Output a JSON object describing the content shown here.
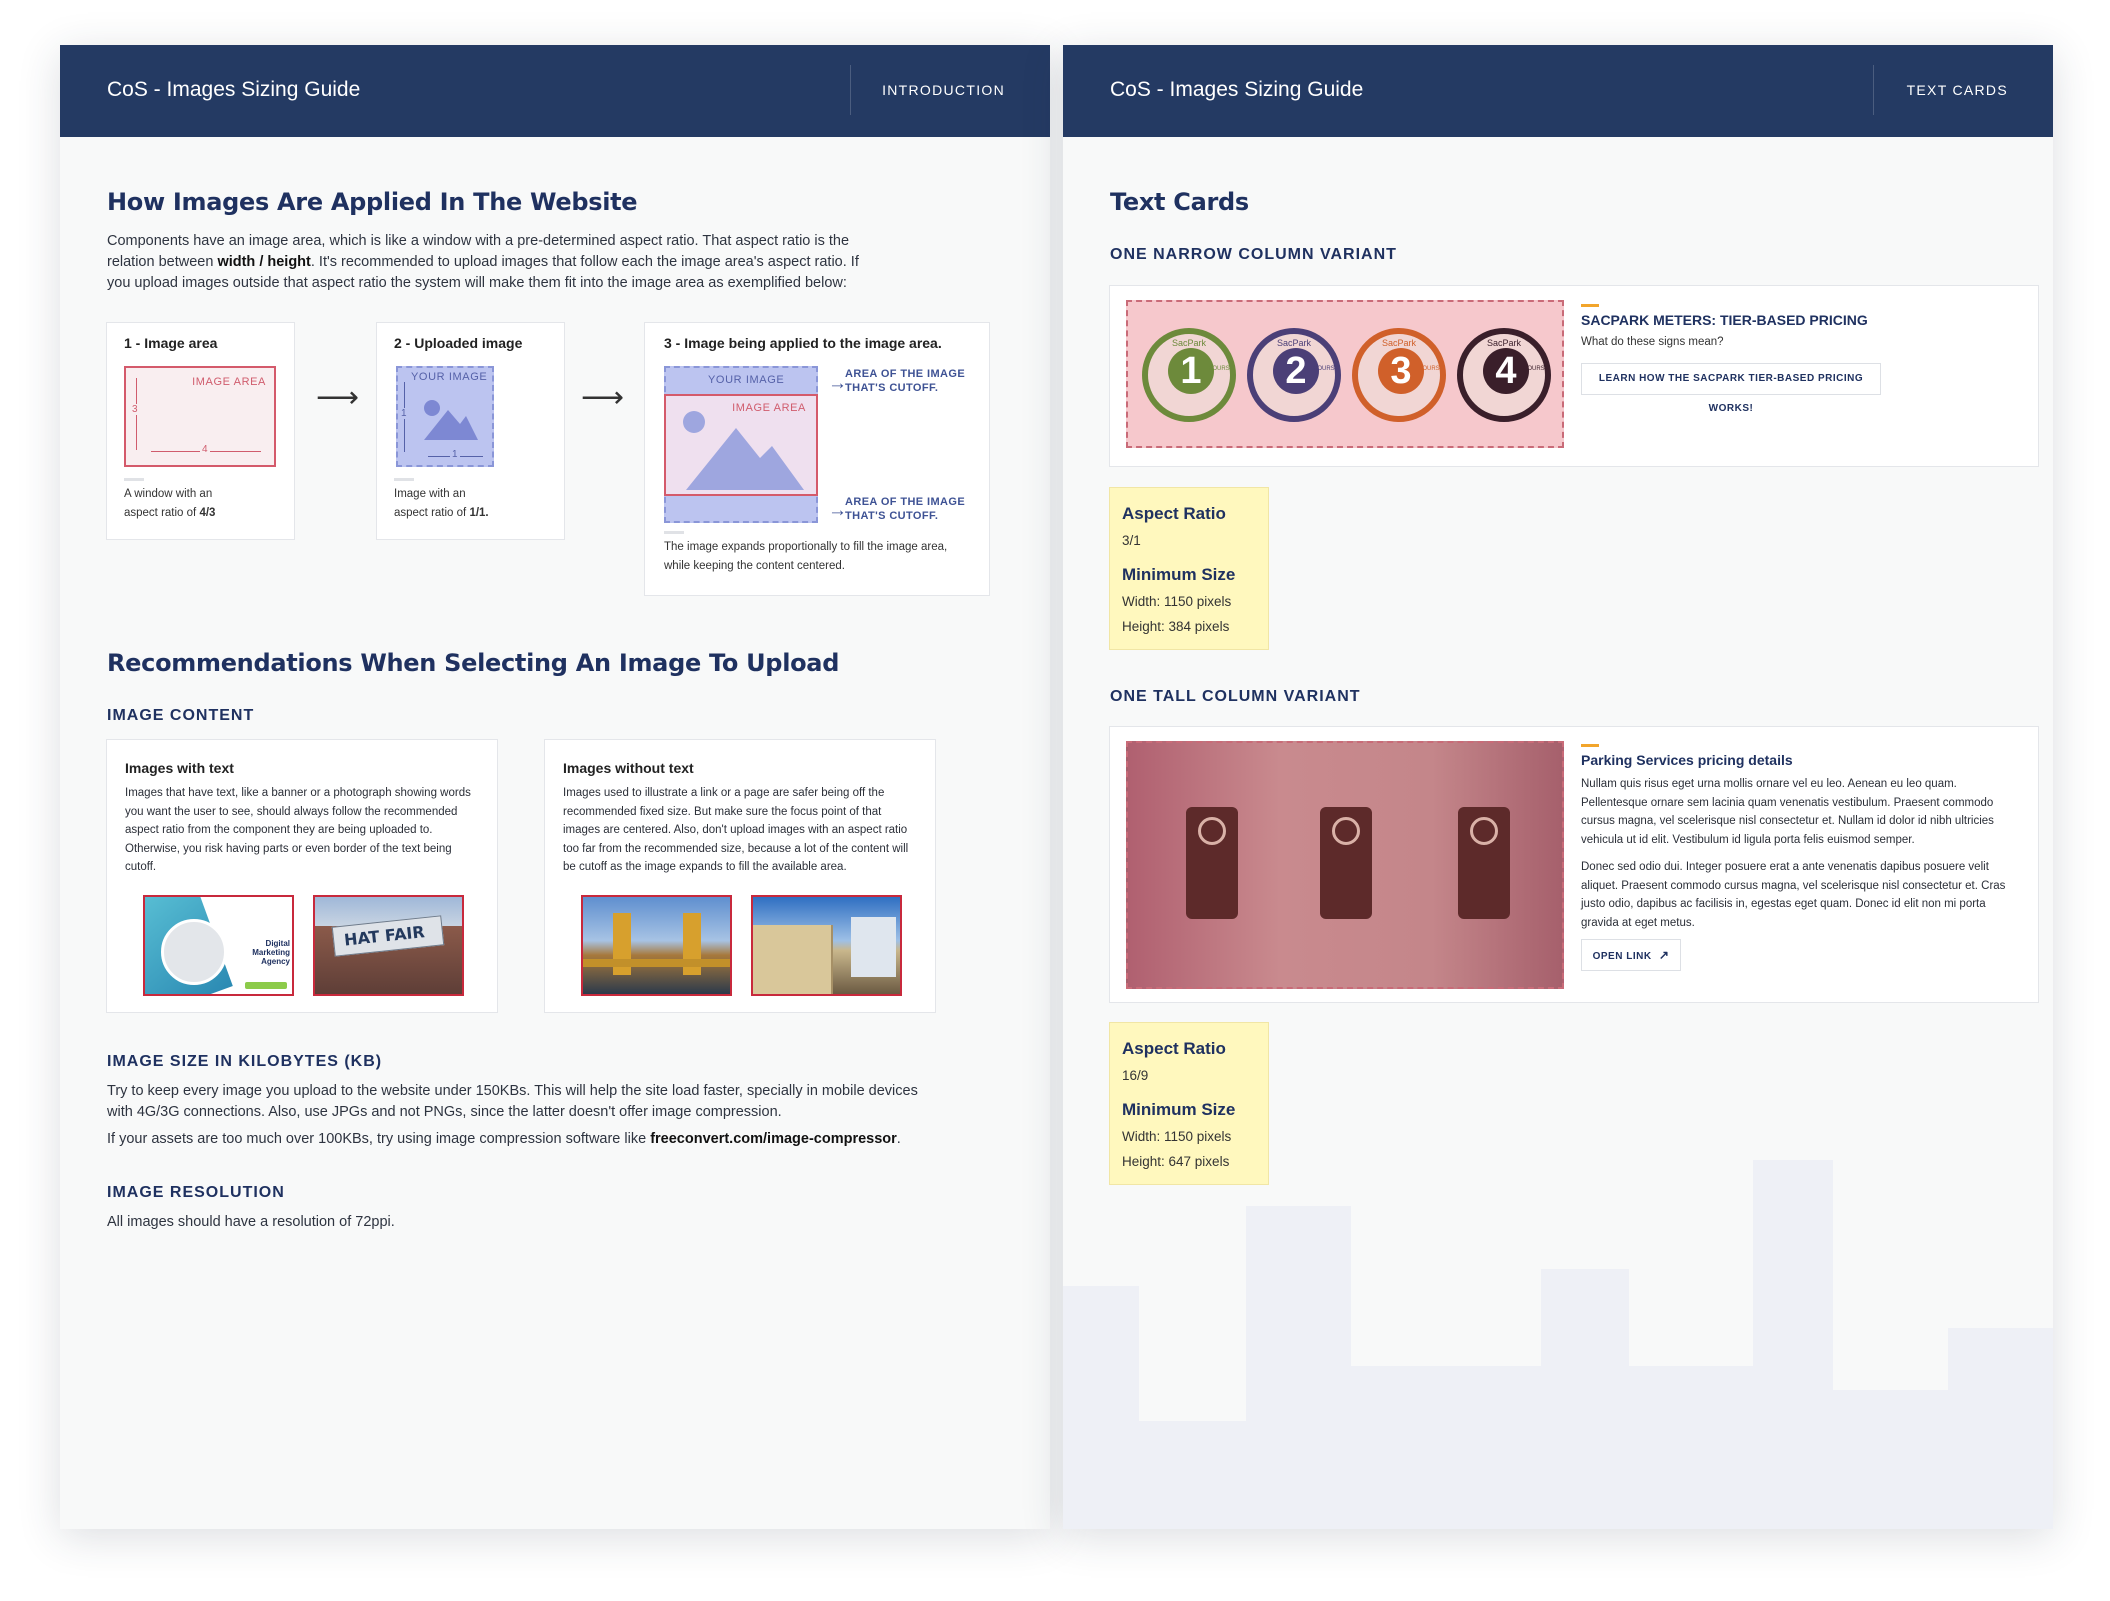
{
  "left": {
    "header": {
      "title": "CoS - Images Sizing Guide",
      "section": "INTRODUCTION"
    },
    "section1": {
      "heading": "How Images Are Applied In The Website",
      "intro_a": "Components have an image area, which is like a window with a pre-determined aspect ratio. That aspect ratio is the",
      "intro_b_pre": "relation between ",
      "intro_b_bold": "width / height",
      "intro_b_post": ". It's recommended to upload images that follow each the image area's aspect ratio. If",
      "intro_c": "you upload images outside that aspect ratio the system will make them fit into the image area as exemplified below:"
    },
    "diagram": {
      "card1": {
        "title": "1 - Image area",
        "box_label": "IMAGE AREA",
        "dim_h": "3",
        "dim_w": "4",
        "caption_a": "A window with an",
        "caption_b_pre": "aspect ratio of ",
        "caption_b_bold": "4/3"
      },
      "card2": {
        "title": "2 - Uploaded image",
        "box_label": "YOUR IMAGE",
        "dim_h": "1",
        "dim_w": "1",
        "caption_a": "Image with an",
        "caption_b_pre": "aspect ratio of ",
        "caption_b_bold": "1/1."
      },
      "card3": {
        "title": "3 - Image being applied to the image area.",
        "your_image": "YOUR IMAGE",
        "image_area": "IMAGE AREA",
        "cutoff_a": "AREA OF THE IMAGE",
        "cutoff_b": "THAT'S CUTOFF.",
        "caption_a": "The image expands proportionally to fill the image area,",
        "caption_b": "while keeping the content centered."
      }
    },
    "section2": {
      "heading": "Recommendations When Selecting An Image To Upload",
      "image_content": "IMAGE CONTENT",
      "with_text": {
        "title": "Images with text",
        "lines": [
          "Images that have text, like a banner or a photograph showing words",
          "you want the user to see, should always follow the recommended",
          "aspect ratio from the component they are being uploaded to.",
          "Otherwise, you risk having parts or even border of the text being",
          "cutoff."
        ],
        "thumb1_text": "Digital Marketing Agency",
        "thumb2_text": "HAT FAIR"
      },
      "without_text": {
        "title": "Images without text",
        "lines": [
          "Images used to illustrate a link or a page are safer being off the",
          "recommended fixed size. But make sure the focus point of that",
          "images are centered. Also, don't upload images with an aspect ratio",
          "too far from the recommended size, because a lot of the content will",
          "be cutoff as the image expands to fill the available area."
        ]
      },
      "size_heading": "IMAGE SIZE IN KILOBYTES (KB)",
      "size_a": "Try to keep every image you upload to the website under 150KBs. This will help the site load faster, specially in mobile devices",
      "size_b": "with 4G/3G connections. Also, use JPGs and not PNGs, since the latter doesn't offer image compression.",
      "size_c_pre": "If your assets are too much over 100KBs, try using image compression software like ",
      "size_c_bold": "freeconvert.com/image-compressor",
      "size_c_post": ".",
      "res_heading": "IMAGE RESOLUTION",
      "res_text": "All images should have a resolution of 72ppi."
    }
  },
  "right": {
    "header": {
      "title": "CoS - Images Sizing Guide",
      "section": "TEXT CARDS"
    },
    "heading": "Text Cards",
    "narrow": {
      "label": "ONE NARROW COLUMN VARIANT",
      "card_title": "SACPARK METERS: TIER-BASED PRICING",
      "card_sub": "What do these signs mean?",
      "button": "LEARN HOW THE SACPARK TIER-BASED PRICING WORKS!",
      "badges": [
        {
          "n": "1",
          "color": "#6d8a3b"
        },
        {
          "n": "2",
          "color": "#4b3f77"
        },
        {
          "n": "3",
          "color": "#d0602a"
        },
        {
          "n": "4",
          "color": "#3a1f2a"
        }
      ],
      "badge_brand": "SacPark",
      "badge_unit": "HOURS",
      "ratio_label": "Aspect Ratio",
      "ratio": "3/1",
      "min_label": "Minimum Size",
      "width": "Width: 1150 pixels",
      "height": "Height: 384 pixels"
    },
    "tall": {
      "label": "ONE TALL COLUMN VARIANT",
      "card_title": "Parking Services pricing details",
      "para1": [
        "Nullam quis risus eget urna mollis ornare vel eu leo. Aenean eu leo quam.",
        "Pellentesque ornare sem lacinia quam venenatis vestibulum. Praesent commodo",
        "cursus magna, vel scelerisque nisl consectetur et. Nullam id dolor id nibh ultricies",
        "vehicula ut id elit. Vestibulum id ligula porta felis euismod semper."
      ],
      "para2": [
        "Donec sed odio dui. Integer posuere erat a ante venenatis dapibus posuere velit",
        "aliquet. Praesent commodo cursus magna, vel scelerisque nisl consectetur et. Cras",
        "justo odio, dapibus ac facilisis in, egestas eget quam. Donec id elit non mi porta",
        "gravida at eget metus."
      ],
      "button": "OPEN LINK",
      "ratio_label": "Aspect Ratio",
      "ratio": "16/9",
      "min_label": "Minimum Size",
      "width": "Width: 1150 pixels",
      "height": "Height: 647 pixels"
    }
  }
}
